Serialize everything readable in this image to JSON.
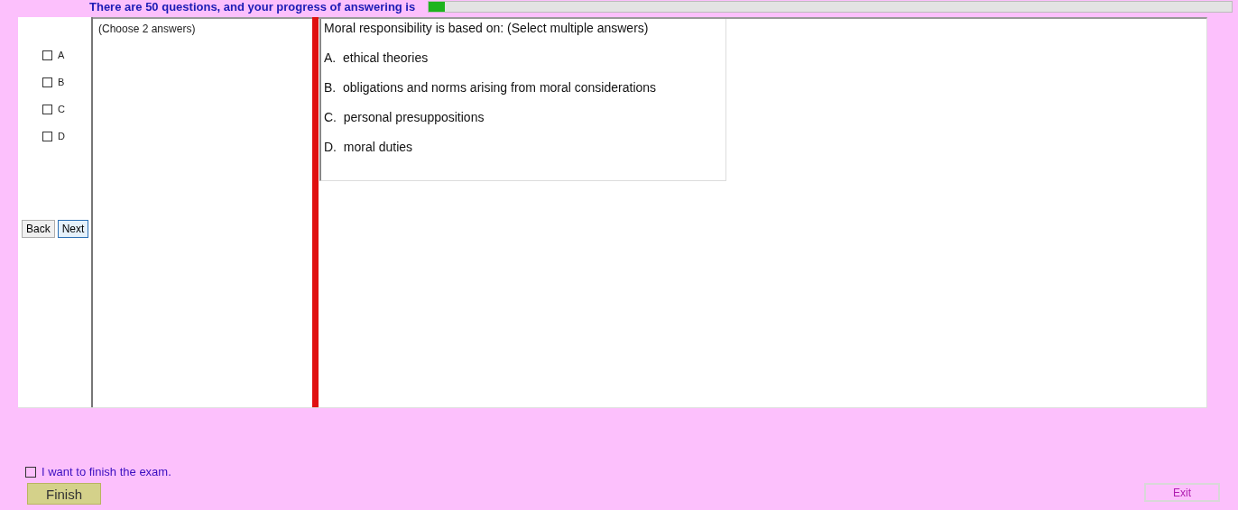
{
  "header": {
    "text": "There are 50 questions, and your progress of answering is",
    "progress": {
      "level": 0.02
    }
  },
  "options": [
    {
      "label": "A",
      "checked": false
    },
    {
      "label": "B",
      "checked": false
    },
    {
      "label": "C",
      "checked": false
    },
    {
      "label": "D",
      "checked": false
    }
  ],
  "nav_buttons": [
    {
      "label": "Back",
      "focused": false
    },
    {
      "label": "Next",
      "focused": true
    }
  ],
  "instruction": "(Choose 2 answers)",
  "question": {
    "text": "Moral responsibility is based on: (Select multiple answers)",
    "answers": [
      "A.  ethical theories",
      "B.  obligations and norms arising from moral considerations",
      "C.  personal presuppositions",
      "D.  moral duties"
    ]
  },
  "finish": {
    "label": "I want to finish the exam.",
    "checked": false,
    "button": "Finish"
  },
  "exit_button": "Exit"
}
